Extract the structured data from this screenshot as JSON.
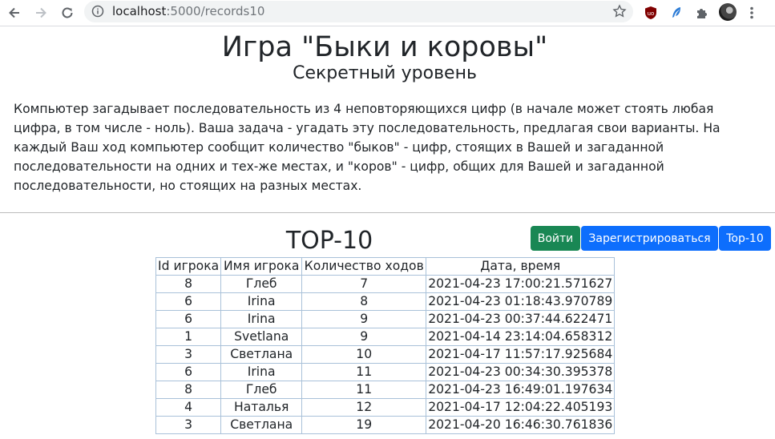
{
  "browser": {
    "url_host": "localhost",
    "url_path": ":5000/records10"
  },
  "header": {
    "title": "Игра \"Быки и коровы\"",
    "subtitle": "Секретный уровень"
  },
  "rules": "Компьютер загадывает последовательность из 4 неповторяющихся цифр (в начале может стоять любая цифра, в том числе - ноль). Ваша задача - угадать эту последовательность, предлагая свои варианты. На каждый Ваш ход компьютер сообщит количество \"быков\" - цифр, стоящих в Вашей и загаданной последовательности на одних и тех-же местах, и \"коров\" - цифр, общих для Вашей и загаданной последовательности, но стоящих на разных местах.",
  "buttons": {
    "login": "Войти",
    "register": "Зарегистрироваться",
    "top10": "Top-10"
  },
  "colors": {
    "login_button": "#198754",
    "primary_button": "#0d6efd",
    "table_border": "#a9c1d9"
  },
  "records": {
    "title": "TOP-10",
    "columns": [
      "Id игрока",
      "Имя игрока",
      "Количество ходов",
      "Дата, время"
    ],
    "rows": [
      [
        "8",
        "Глеб",
        "7",
        "2021-04-23 17:00:21.571627"
      ],
      [
        "6",
        "Irina",
        "8",
        "2021-04-23 01:18:43.970789"
      ],
      [
        "6",
        "Irina",
        "9",
        "2021-04-23 00:37:44.622471"
      ],
      [
        "1",
        "Svetlana",
        "9",
        "2021-04-14 23:14:04.658312"
      ],
      [
        "3",
        "Светлана",
        "10",
        "2021-04-17 11:57:17.925684"
      ],
      [
        "6",
        "Irina",
        "11",
        "2021-04-23 00:34:30.395378"
      ],
      [
        "8",
        "Глеб",
        "11",
        "2021-04-23 16:49:01.197634"
      ],
      [
        "4",
        "Наталья",
        "12",
        "2021-04-17 12:04:22.405193"
      ],
      [
        "3",
        "Светлана",
        "19",
        "2021-04-20 16:46:30.761836"
      ]
    ]
  }
}
